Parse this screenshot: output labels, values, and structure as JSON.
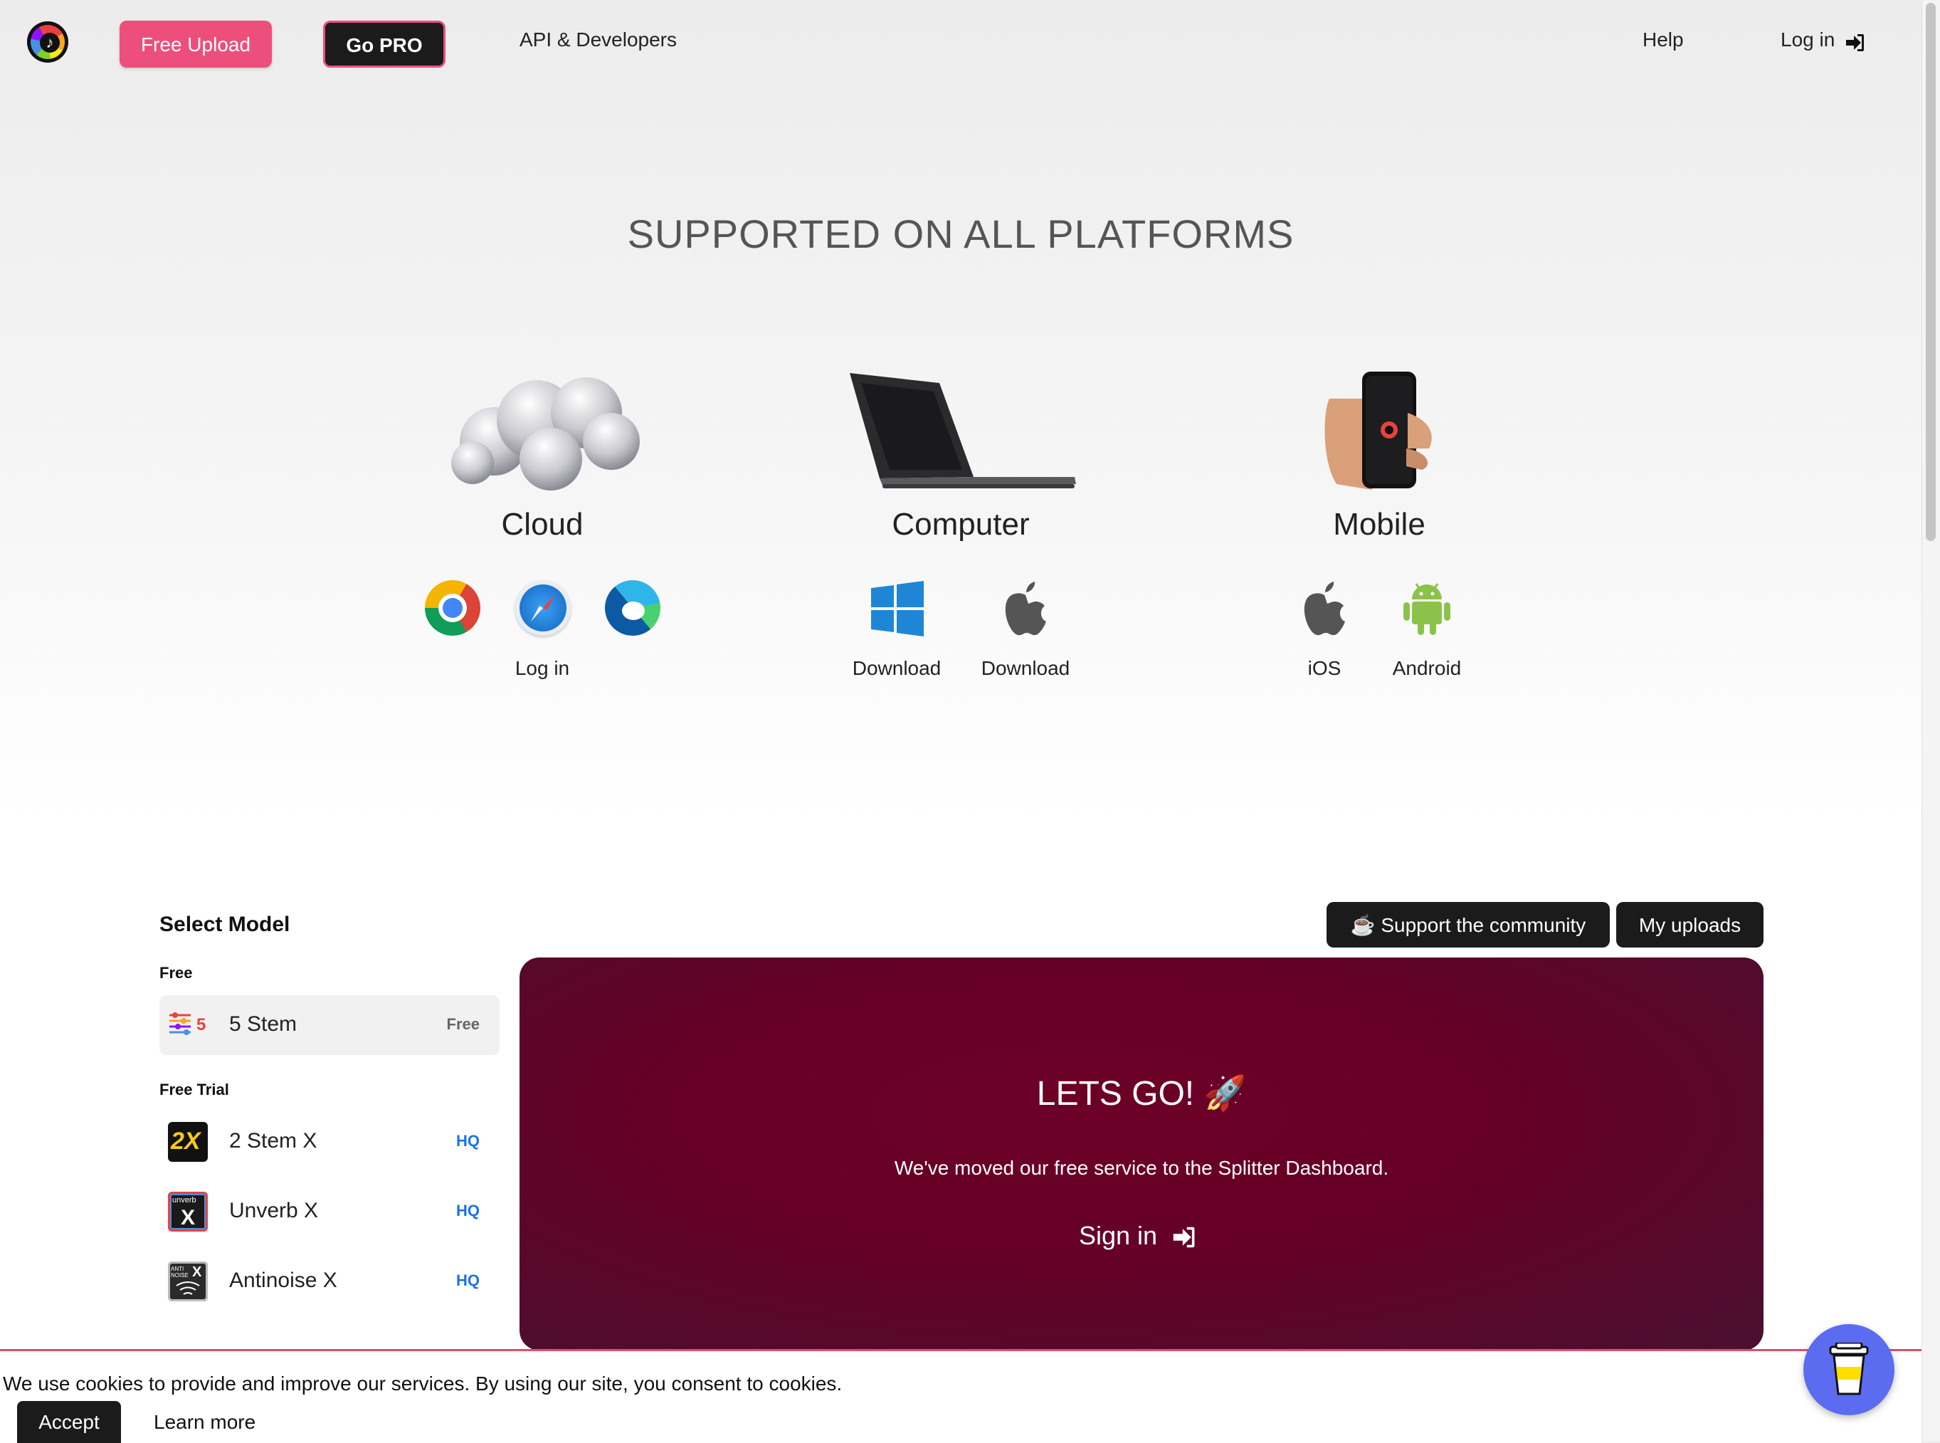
{
  "header": {
    "free_upload": "Free Upload",
    "go_pro": "Go PRO",
    "api": "API & Developers",
    "help": "Help",
    "login": "Log in"
  },
  "hero": {
    "title": "SUPPORTED ON ALL PLATFORMS",
    "cloud": {
      "label": "Cloud",
      "action": "Log in"
    },
    "computer": {
      "label": "Computer",
      "windows": "Download",
      "mac": "Download"
    },
    "mobile": {
      "label": "Mobile",
      "ios": "iOS",
      "android": "Android"
    }
  },
  "models": {
    "title": "Select Model",
    "free_label": "Free",
    "trial_label": "Free Trial",
    "free": [
      {
        "name": "5 Stem",
        "tag": "Free",
        "badge": "5"
      }
    ],
    "trial": [
      {
        "name": "2 Stem X",
        "tag": "HQ",
        "badge": "2X"
      },
      {
        "name": "Unverb X",
        "tag": "HQ",
        "badge": "X",
        "badge_small": "unverb"
      },
      {
        "name": "Antinoise X",
        "tag": "HQ",
        "badge": "X",
        "badge_small": "ANTI NOISE"
      }
    ]
  },
  "actions": {
    "support": "☕ Support the community",
    "uploads": "My uploads"
  },
  "panel": {
    "title": "LETS GO! 🚀",
    "subtitle": "We've moved our free service to the Splitter Dashboard.",
    "signin": "Sign in"
  },
  "cookie": {
    "text": "We use cookies to provide and improve our services. By using our site, you consent to cookies.",
    "accept": "Accept",
    "learn": "Learn more"
  },
  "colors": {
    "free_upload": "#ec4f7c",
    "dark": "#1b1b1b",
    "panel": "#650026",
    "hq": "#1a73e8",
    "coffee": "#5c6cf0"
  }
}
